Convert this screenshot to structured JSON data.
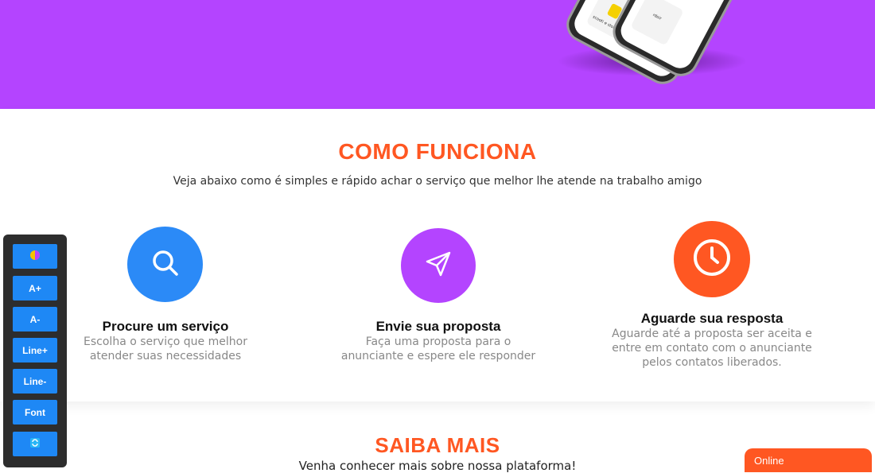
{
  "hero": {
    "background_color": "#b444ff",
    "phone_tiles": [
      "scooti e stoni",
      "rdoir"
    ]
  },
  "como_funciona": {
    "title": "COMO FUNCIONA",
    "subtitle": "Veja abaixo como é simples e rápido achar o serviço que melhor lhe atende na trabalho amigo",
    "title_color": "#ff5722",
    "steps": [
      {
        "icon": "search-icon",
        "color": "#2b8af7",
        "title": "Procure um serviço",
        "desc_lines": [
          "Escolha o serviço que melhor",
          "atender suas necessidades"
        ]
      },
      {
        "icon": "send-icon",
        "color": "#b444ff",
        "title": "Envie sua proposta",
        "desc_lines": [
          "Faça uma proposta para o",
          "anunciante e espere ele responder"
        ]
      },
      {
        "icon": "clock-icon",
        "color": "#ff5722",
        "title": "Aguarde sua resposta",
        "desc_lines": [
          "Aguarde até a proposta ser aceita e",
          "entre em contato com o anunciante",
          "pelos contatos liberados."
        ]
      }
    ]
  },
  "saiba_mais": {
    "title": "SAIBA MAIS",
    "subtitle": "Venha conhecer mais sobre nossa plataforma!"
  },
  "accessibility_toolbar": {
    "buttons": [
      {
        "label": "",
        "icon": "contrast-icon"
      },
      {
        "label": "A+"
      },
      {
        "label": "A-"
      },
      {
        "label": "Line+"
      },
      {
        "label": "Line-"
      },
      {
        "label": "Font"
      },
      {
        "label": "",
        "icon": "reset-icon"
      }
    ]
  },
  "chat": {
    "label": "Online",
    "color": "#ff5722"
  }
}
